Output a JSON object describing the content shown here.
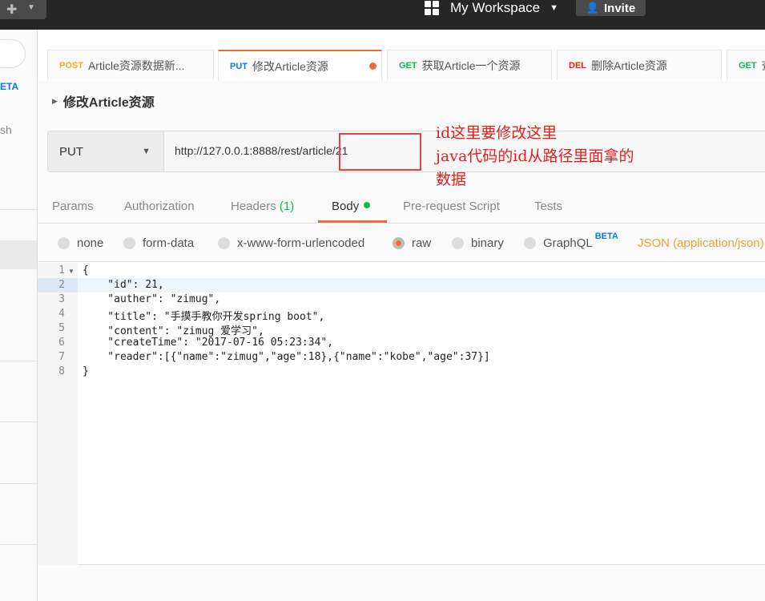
{
  "topbar": {
    "workspace": "My Workspace",
    "invite": "Invite"
  },
  "sidebar": {
    "beta": "ETA",
    "trash": "sh"
  },
  "tabs": [
    {
      "method": "POST",
      "label": "Article资源数据新..."
    },
    {
      "method": "PUT",
      "label": "修改Article资源"
    },
    {
      "method": "GET",
      "label": "获取Article一个资源"
    },
    {
      "method": "DEL",
      "label": "删除Article资源"
    },
    {
      "method": "GET",
      "label": "查"
    }
  ],
  "request": {
    "title": "修改Article资源",
    "method": "PUT",
    "url": "http://127.0.0.1:8888/rest/article/21"
  },
  "annotation": {
    "line1": "id这里要修改这里",
    "line2": "java代码的id从路径里面拿的",
    "line3": "数据"
  },
  "subtabs": {
    "params": "Params",
    "authorization": "Authorization",
    "headers": "Headers",
    "headers_count": "(1)",
    "body": "Body",
    "prerequest": "Pre-request Script",
    "tests": "Tests"
  },
  "body_options": {
    "none": "none",
    "form_data": "form-data",
    "urlencoded": "x-www-form-urlencoded",
    "raw": "raw",
    "binary": "binary",
    "graphql": "GraphQL",
    "graphql_badge": "BETA",
    "content_type": "JSON (application/json)",
    "selected": "raw"
  },
  "editor": {
    "line_numbers": [
      "1",
      "2",
      "3",
      "4",
      "5",
      "6",
      "7",
      "8"
    ],
    "lines": [
      "{",
      "    \"id\": 21,",
      "    \"auther\": \"zimug\",",
      "    \"title\": \"手摸手教你开发spring boot\",",
      "    \"content\": \"zimug 爱学习\",",
      "    \"createTime\": \"2017-07-16 05:23:34\",",
      "    \"reader\":[{\"name\":\"zimug\",\"age\":18},{\"name\":\"kobe\",\"age\":37}]",
      "}"
    ]
  },
  "colors": {
    "accent": "#f26b3a",
    "annotation": "#e02020",
    "green": "#0cbb52",
    "blue": "#097bed"
  }
}
